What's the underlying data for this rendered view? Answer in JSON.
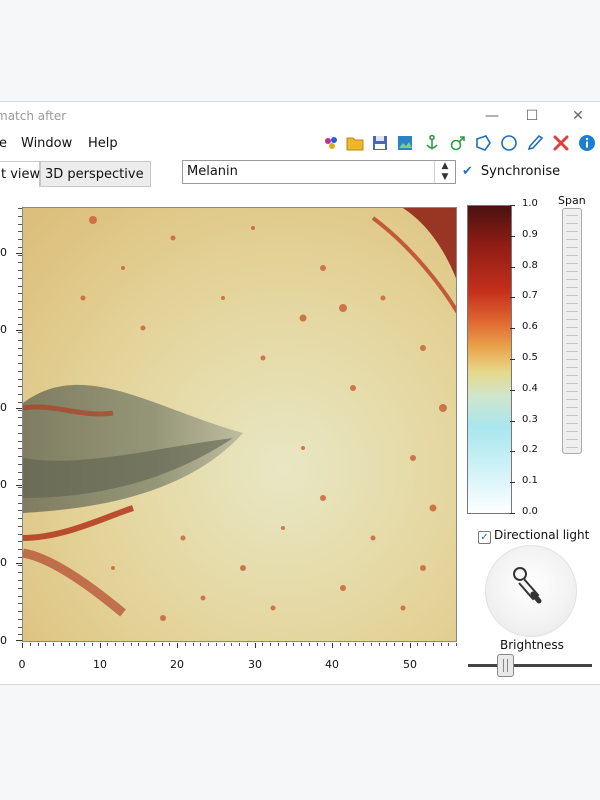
{
  "window": {
    "title": "match after",
    "controls": {
      "minimize": "—",
      "maximize": "☐",
      "close": "✕"
    }
  },
  "menu": {
    "items": [
      "e",
      "Window",
      "Help"
    ]
  },
  "toolbar": {
    "icons": [
      "palette-icon",
      "folder-icon",
      "save-icon",
      "image-export-icon",
      "anchor-icon",
      "gender-icon",
      "polygon-icon",
      "circle-icon",
      "brush-icon",
      "delete-icon",
      "info-icon"
    ]
  },
  "tabs": [
    {
      "label": "t view",
      "active": true
    },
    {
      "label": "3D perspective",
      "active": false
    }
  ],
  "layer_select": {
    "value": "Melanin"
  },
  "synchronise": {
    "label": "Synchronise",
    "checked": true
  },
  "colorbar": {
    "ticks": [
      "1.0",
      "0.9",
      "0.8",
      "0.7",
      "0.6",
      "0.5",
      "0.4",
      "0.3",
      "0.2",
      "0.1",
      "0.0"
    ]
  },
  "span": {
    "label": "Span"
  },
  "x_axis": {
    "ticks": [
      "0",
      "10",
      "20",
      "30",
      "40",
      "50"
    ]
  },
  "y_axis": {
    "stub": "0"
  },
  "directional_light": {
    "label": "Directional light",
    "checked": true
  },
  "brightness": {
    "label": "Brightness"
  },
  "colors": {
    "accent": "#2a6fcc",
    "melanin_high": "#8c1c14",
    "melanin_low": "#a9e6ee"
  }
}
